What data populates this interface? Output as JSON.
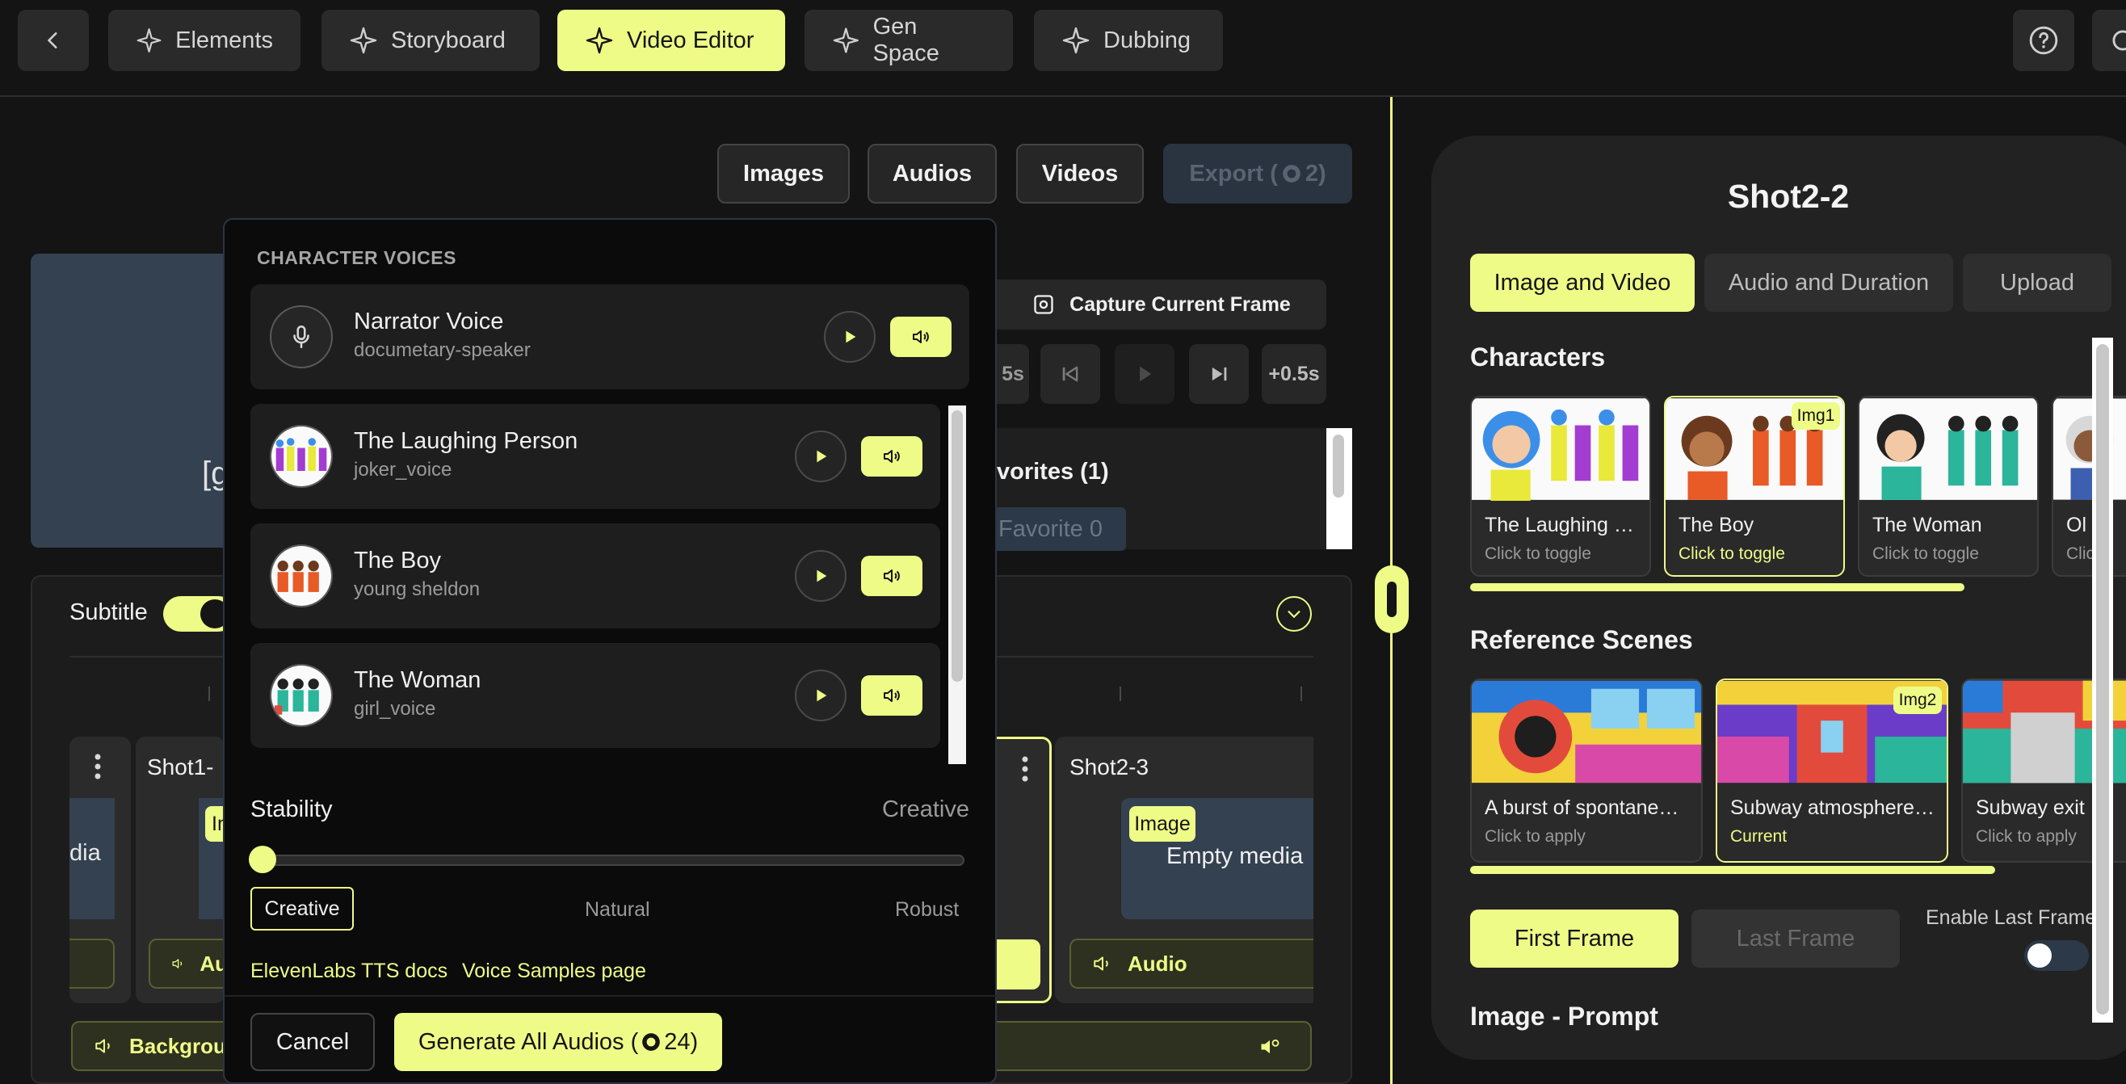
{
  "nav": {
    "tabs": [
      {
        "label": "Elements"
      },
      {
        "label": "Storyboard"
      },
      {
        "label": "Video Editor"
      },
      {
        "label": "Gen Space"
      },
      {
        "label": "Dubbing"
      }
    ]
  },
  "media_buttons": {
    "images": "Images",
    "audios": "Audios",
    "videos": "Videos",
    "export": "Export (",
    "export_cost": "2)"
  },
  "preview": {
    "capture_label": "Capture Current Frame",
    "back_label": "5s",
    "forward_label": "+0.5s",
    "favorites_label": "vorites (1)",
    "favorite_chip": "Favorite 0",
    "placeholder_text": "[g"
  },
  "timeline": {
    "subtitle_label": "Subtitle",
    "shots": [
      {
        "title": "Shot1-",
        "media_text": "dia",
        "tag": "Im",
        "audio": "Au"
      },
      {
        "title": "Shot2-3",
        "media_text": "Empty media",
        "tag": "Image",
        "audio": "Audio"
      }
    ],
    "background_label": "Backgrour"
  },
  "modal": {
    "heading": "CHARACTER VOICES",
    "voices": [
      {
        "name": "Narrator Voice",
        "voice_id": "documetary-speaker"
      },
      {
        "name": "The Laughing Person",
        "voice_id": "joker_voice"
      },
      {
        "name": "The Boy",
        "voice_id": "young sheldon"
      },
      {
        "name": "The Woman",
        "voice_id": "girl_voice"
      }
    ],
    "stability_label": "Stability",
    "stability_value": "Creative",
    "stability_level": 0.0,
    "presets": [
      "Creative",
      "Natural",
      "Robust"
    ],
    "links": {
      "docs": "ElevenLabs TTS docs",
      "samples": "Voice Samples page"
    },
    "cancel_label": "Cancel",
    "generate_label": "Generate All Audios (",
    "generate_cost": "24)"
  },
  "right_panel": {
    "title": "Shot2-2",
    "tabs": [
      "Image and Video",
      "Audio and Duration",
      "Upload"
    ],
    "characters_heading": "Characters",
    "characters": [
      {
        "name": "The Laughing …",
        "status": "Click to toggle"
      },
      {
        "name": "The Boy",
        "status": "Click to toggle",
        "badge": "Img1"
      },
      {
        "name": "The Woman",
        "status": "Click to toggle"
      },
      {
        "name": "Ol",
        "status": "Clic"
      }
    ],
    "scenes_heading": "Reference Scenes",
    "scenes": [
      {
        "name": "A burst of spontane…",
        "status": "Click to apply"
      },
      {
        "name": "Subway atmosphere…",
        "status": "Current",
        "badge": "Img2"
      },
      {
        "name": "Subway exit",
        "status": "Click to apply"
      }
    ],
    "first_frame_label": "First Frame",
    "last_frame_label": "Last Frame",
    "enable_last_frame_label": "Enable Last Frame",
    "prompt_heading": "Image - Prompt"
  },
  "colors": {
    "accent": "#eefc87",
    "bg": "#141414",
    "panel": "#222222"
  }
}
